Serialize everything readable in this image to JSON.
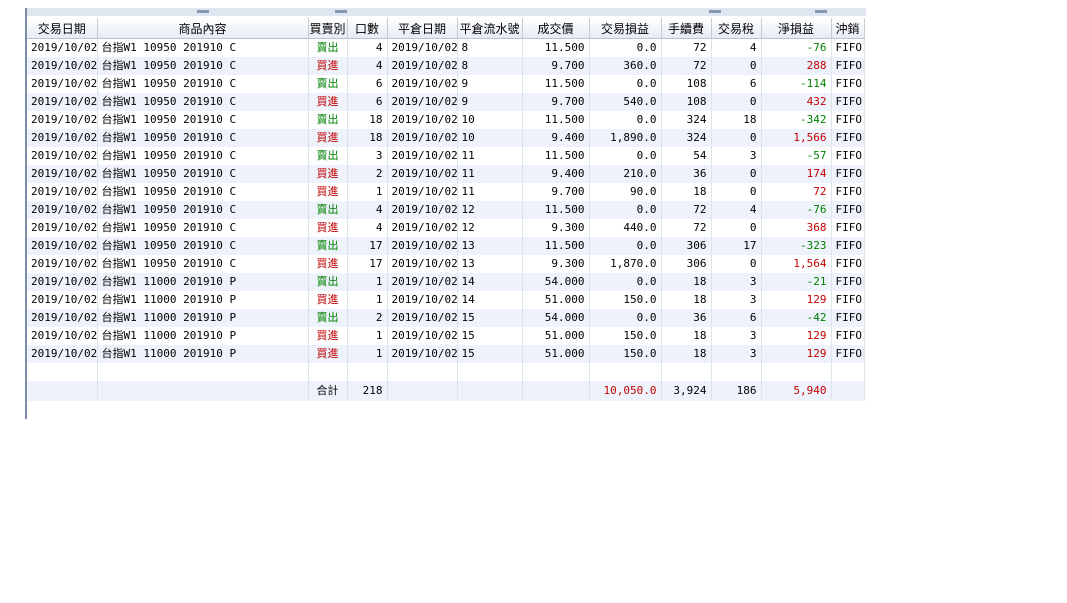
{
  "columns": [
    "交易日期",
    "商品內容",
    "買賣別",
    "口數",
    "平倉日期",
    "平倉流水號",
    "成交價",
    "交易損益",
    "手續費",
    "交易稅",
    "淨損益",
    "沖銷"
  ],
  "rows": [
    {
      "date": "2019/10/02",
      "product": "台指W1 10950 201910 C",
      "side": "賣出",
      "side_type": "sell",
      "qty": "4",
      "close_date": "2019/10/02",
      "seq": "8",
      "price": "11.500",
      "pl": "0.0",
      "fee": "72",
      "tax": "4",
      "net": "-76",
      "net_type": "neg",
      "method": "FIFO"
    },
    {
      "date": "2019/10/02",
      "product": "台指W1 10950 201910 C",
      "side": "買進",
      "side_type": "buy",
      "qty": "4",
      "close_date": "2019/10/02",
      "seq": "8",
      "price": "9.700",
      "pl": "360.0",
      "fee": "72",
      "tax": "0",
      "net": "288",
      "net_type": "pos",
      "method": "FIFO"
    },
    {
      "date": "2019/10/02",
      "product": "台指W1 10950 201910 C",
      "side": "賣出",
      "side_type": "sell",
      "qty": "6",
      "close_date": "2019/10/02",
      "seq": "9",
      "price": "11.500",
      "pl": "0.0",
      "fee": "108",
      "tax": "6",
      "net": "-114",
      "net_type": "neg",
      "method": "FIFO"
    },
    {
      "date": "2019/10/02",
      "product": "台指W1 10950 201910 C",
      "side": "買進",
      "side_type": "buy",
      "qty": "6",
      "close_date": "2019/10/02",
      "seq": "9",
      "price": "9.700",
      "pl": "540.0",
      "fee": "108",
      "tax": "0",
      "net": "432",
      "net_type": "pos",
      "method": "FIFO"
    },
    {
      "date": "2019/10/02",
      "product": "台指W1 10950 201910 C",
      "side": "賣出",
      "side_type": "sell",
      "qty": "18",
      "close_date": "2019/10/02",
      "seq": "10",
      "price": "11.500",
      "pl": "0.0",
      "fee": "324",
      "tax": "18",
      "net": "-342",
      "net_type": "neg",
      "method": "FIFO"
    },
    {
      "date": "2019/10/02",
      "product": "台指W1 10950 201910 C",
      "side": "買進",
      "side_type": "buy",
      "qty": "18",
      "close_date": "2019/10/02",
      "seq": "10",
      "price": "9.400",
      "pl": "1,890.0",
      "fee": "324",
      "tax": "0",
      "net": "1,566",
      "net_type": "pos",
      "method": "FIFO"
    },
    {
      "date": "2019/10/02",
      "product": "台指W1 10950 201910 C",
      "side": "賣出",
      "side_type": "sell",
      "qty": "3",
      "close_date": "2019/10/02",
      "seq": "11",
      "price": "11.500",
      "pl": "0.0",
      "fee": "54",
      "tax": "3",
      "net": "-57",
      "net_type": "neg",
      "method": "FIFO"
    },
    {
      "date": "2019/10/02",
      "product": "台指W1 10950 201910 C",
      "side": "買進",
      "side_type": "buy",
      "qty": "2",
      "close_date": "2019/10/02",
      "seq": "11",
      "price": "9.400",
      "pl": "210.0",
      "fee": "36",
      "tax": "0",
      "net": "174",
      "net_type": "pos",
      "method": "FIFO"
    },
    {
      "date": "2019/10/02",
      "product": "台指W1 10950 201910 C",
      "side": "買進",
      "side_type": "buy",
      "qty": "1",
      "close_date": "2019/10/02",
      "seq": "11",
      "price": "9.700",
      "pl": "90.0",
      "fee": "18",
      "tax": "0",
      "net": "72",
      "net_type": "pos",
      "method": "FIFO"
    },
    {
      "date": "2019/10/02",
      "product": "台指W1 10950 201910 C",
      "side": "賣出",
      "side_type": "sell",
      "qty": "4",
      "close_date": "2019/10/02",
      "seq": "12",
      "price": "11.500",
      "pl": "0.0",
      "fee": "72",
      "tax": "4",
      "net": "-76",
      "net_type": "neg",
      "method": "FIFO"
    },
    {
      "date": "2019/10/02",
      "product": "台指W1 10950 201910 C",
      "side": "買進",
      "side_type": "buy",
      "qty": "4",
      "close_date": "2019/10/02",
      "seq": "12",
      "price": "9.300",
      "pl": "440.0",
      "fee": "72",
      "tax": "0",
      "net": "368",
      "net_type": "pos",
      "method": "FIFO"
    },
    {
      "date": "2019/10/02",
      "product": "台指W1 10950 201910 C",
      "side": "賣出",
      "side_type": "sell",
      "qty": "17",
      "close_date": "2019/10/02",
      "seq": "13",
      "price": "11.500",
      "pl": "0.0",
      "fee": "306",
      "tax": "17",
      "net": "-323",
      "net_type": "neg",
      "method": "FIFO"
    },
    {
      "date": "2019/10/02",
      "product": "台指W1 10950 201910 C",
      "side": "買進",
      "side_type": "buy",
      "qty": "17",
      "close_date": "2019/10/02",
      "seq": "13",
      "price": "9.300",
      "pl": "1,870.0",
      "fee": "306",
      "tax": "0",
      "net": "1,564",
      "net_type": "pos",
      "method": "FIFO"
    },
    {
      "date": "2019/10/02",
      "product": "台指W1 11000 201910 P",
      "side": "賣出",
      "side_type": "sell",
      "qty": "1",
      "close_date": "2019/10/02",
      "seq": "14",
      "price": "54.000",
      "pl": "0.0",
      "fee": "18",
      "tax": "3",
      "net": "-21",
      "net_type": "neg",
      "method": "FIFO"
    },
    {
      "date": "2019/10/02",
      "product": "台指W1 11000 201910 P",
      "side": "買進",
      "side_type": "buy",
      "qty": "1",
      "close_date": "2019/10/02",
      "seq": "14",
      "price": "51.000",
      "pl": "150.0",
      "fee": "18",
      "tax": "3",
      "net": "129",
      "net_type": "pos",
      "method": "FIFO"
    },
    {
      "date": "2019/10/02",
      "product": "台指W1 11000 201910 P",
      "side": "賣出",
      "side_type": "sell",
      "qty": "2",
      "close_date": "2019/10/02",
      "seq": "15",
      "price": "54.000",
      "pl": "0.0",
      "fee": "36",
      "tax": "6",
      "net": "-42",
      "net_type": "neg",
      "method": "FIFO"
    },
    {
      "date": "2019/10/02",
      "product": "台指W1 11000 201910 P",
      "side": "買進",
      "side_type": "buy",
      "qty": "1",
      "close_date": "2019/10/02",
      "seq": "15",
      "price": "51.000",
      "pl": "150.0",
      "fee": "18",
      "tax": "3",
      "net": "129",
      "net_type": "pos",
      "method": "FIFO"
    },
    {
      "date": "2019/10/02",
      "product": "台指W1 11000 201910 P",
      "side": "買進",
      "side_type": "buy",
      "qty": "1",
      "close_date": "2019/10/02",
      "seq": "15",
      "price": "51.000",
      "pl": "150.0",
      "fee": "18",
      "tax": "3",
      "net": "129",
      "net_type": "pos",
      "method": "FIFO"
    }
  ],
  "totals": {
    "label": "合計",
    "qty": "218",
    "pl": "10,050.0",
    "fee": "3,924",
    "tax": "186",
    "net": "5,940"
  },
  "colors": {
    "sell": "#008000",
    "buy": "#c00000",
    "header_bg": "#e6ecf4",
    "alt_row": "#eef3fb"
  }
}
